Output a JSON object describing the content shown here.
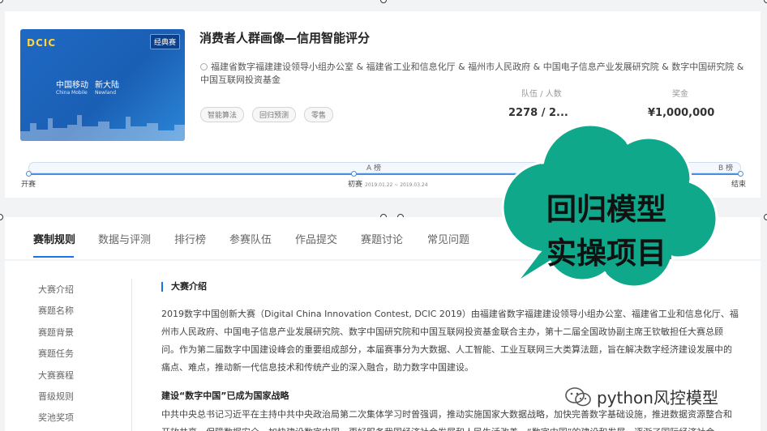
{
  "competition": {
    "banner": {
      "logo": "DCIC",
      "tag": "经典赛",
      "brand1": "中国移动",
      "brand1_en": "China Mobile",
      "brand2": "新大陆",
      "brand2_en": "Newland"
    },
    "title": "消费者人群画像—信用智能评分",
    "organizers": "福建省数字福建建设领导小组办公室 & 福建省工业和信息化厅 & 福州市人民政府 & 中国电子信息产业发展研究院 & 数字中国研究院 & 中国互联网投资基金",
    "tags": [
      "智能算法",
      "回归预测",
      "零售"
    ],
    "stats": [
      {
        "label": "队伍 / 人数",
        "value": "2278 / 2..."
      },
      {
        "label": "奖金",
        "value": "¥1,000,000"
      }
    ],
    "timeline": {
      "a_label": "A 榜",
      "b_label": "B 榜",
      "start": "开赛",
      "prelim": "初赛",
      "prelim_dates": "2019.01.22 ~ 2019.03.24",
      "end": "结束"
    }
  },
  "tabs": [
    "赛制规则",
    "数据与评测",
    "排行榜",
    "参赛队伍",
    "作品提交",
    "赛题讨论",
    "常见问题"
  ],
  "sidebar": [
    "大赛介绍",
    "赛题名称",
    "赛题背景",
    "赛题任务",
    "大赛赛程",
    "晋级规则",
    "奖池奖项"
  ],
  "intro": {
    "title": "大赛介绍",
    "paragraph": "2019数字中国创新大赛（Digital China Innovation Contest, DCIC 2019）由福建省数字福建建设领导小组办公室、福建省工业和信息化厅、福州市人民政府、中国电子信息产业发展研究院、数字中国研究院和中国互联网投资基金联合主办，第十二届全国政协副主席王钦敏担任大赛总顾问。作为第二届数字中国建设峰会的重要组成部分，本届赛事分为大数据、人工智能、工业互联网三大类算法题，旨在解决数字经济建设发展中的痛点、难点，推动新一代信息技术和传统产业的深入融合，助力数字中国建设。",
    "subtitle": "建设“数字中国”已成为国家战略",
    "paragraph2": "中共中央总书记习近平在主持中共中央政治局第二次集体学习时曾强调，推动实施国家大数据战略，加快完善数字基础设施，推进数据资源整合和开放共享，保障数据安全，加快建设数字中国，更好服务我国经济社会发展和人民生活改善。“数字中国”的建设和发展，逐渐了国际经济社会"
  },
  "overlay": {
    "line1": "回归模型",
    "line2": "实操项目",
    "color": "#0fa88a"
  },
  "watermark": {
    "text": "python风控模型"
  }
}
